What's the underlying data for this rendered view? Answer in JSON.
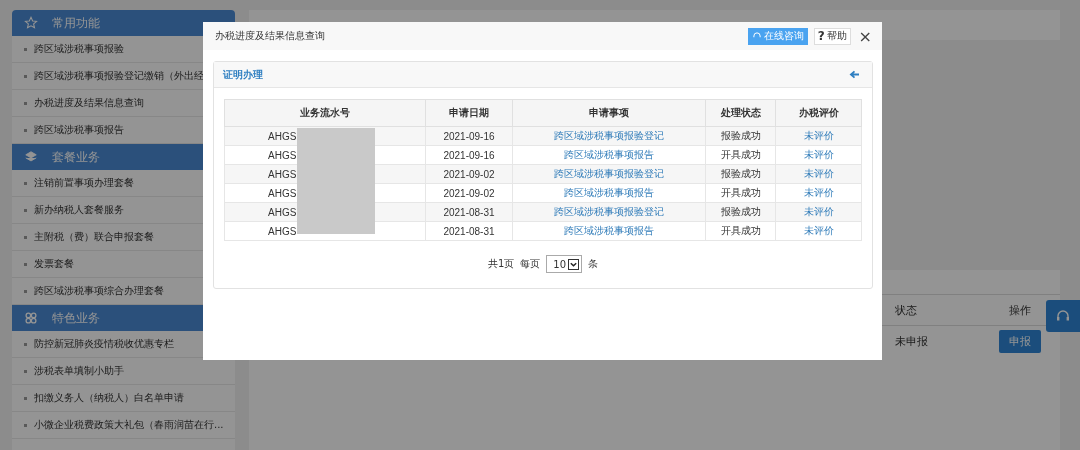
{
  "sidebar": {
    "groups": [
      {
        "title": "常用功能",
        "items": [
          "跨区域涉税事项报验",
          "跨区域涉税事项报验登记缴销（外出经",
          "办税进度及结果信息查询",
          "跨区域涉税事项报告"
        ]
      },
      {
        "title": "套餐业务",
        "items": [
          "注销前置事项办理套餐",
          "新办纳税人套餐服务",
          "主附税（费）联合申报套餐",
          "发票套餐",
          "跨区域涉税事项综合办理套餐"
        ]
      },
      {
        "title": "特色业务",
        "items": [
          "防控新冠肺炎疫情税收优惠专栏",
          "涉税表单填制小助手",
          "扣缴义务人（纳税人）白名单申请",
          "小微企业税费政策大礼包（春雨润苗在行..."
        ]
      }
    ]
  },
  "background_table": {
    "columns": [
      "状态",
      "操作"
    ],
    "rows": [
      {
        "status": "未申报",
        "action": "申报"
      }
    ]
  },
  "modal": {
    "title": "办税进度及结果信息查询",
    "consult_button": "在线咨询",
    "help_glyph": "?",
    "help_button": "帮助",
    "close_glyph": "×",
    "panel": {
      "title": "证明办理",
      "columns": [
        "业务流水号",
        "申请日期",
        "申请事项",
        "处理状态",
        "办税评价"
      ],
      "rows": [
        {
          "serial": "AHGS",
          "date": "2021-09-16",
          "item": "跨区域涉税事项报验登记",
          "status": "报验成功",
          "rating": "未评价"
        },
        {
          "serial": "AHGS",
          "date": "2021-09-16",
          "item": "跨区域涉税事项报告",
          "status": "开具成功",
          "rating": "未评价"
        },
        {
          "serial": "AHGS",
          "date": "2021-09-02",
          "item": "跨区域涉税事项报验登记",
          "status": "报验成功",
          "rating": "未评价"
        },
        {
          "serial": "AHGS",
          "date": "2021-09-02",
          "item": "跨区域涉税事项报告",
          "status": "开具成功",
          "rating": "未评价"
        },
        {
          "serial": "AHGS",
          "date": "2021-08-31",
          "item": "跨区域涉税事项报验登记",
          "status": "报验成功",
          "rating": "未评价"
        },
        {
          "serial": "AHGS",
          "date": "2021-08-31",
          "item": "跨区域涉税事项报告",
          "status": "开具成功",
          "rating": "未评价"
        }
      ]
    },
    "pagination": {
      "total": "共1页",
      "per_page_label": "每页",
      "per_page": "10",
      "unit": "条"
    }
  }
}
